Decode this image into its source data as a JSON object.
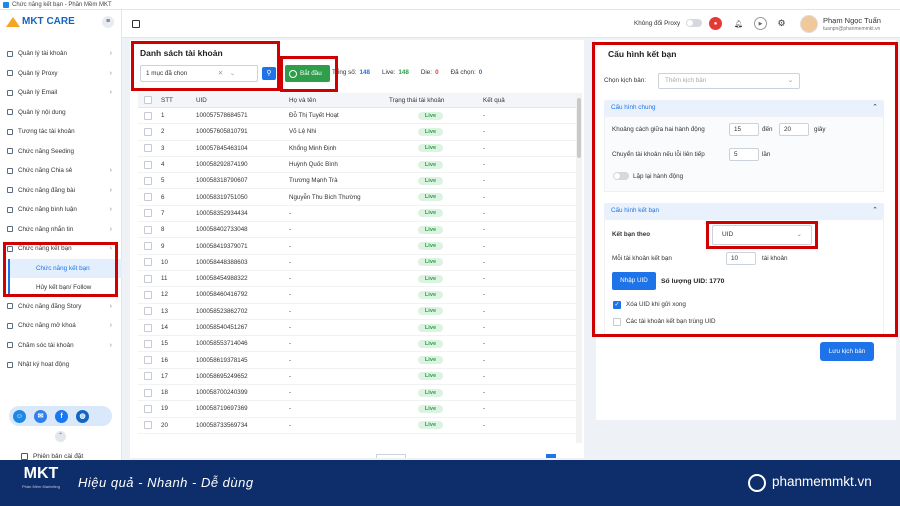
{
  "window": {
    "title": "Chức năng kết bạn - Phần Mềm MKT"
  },
  "brand": {
    "name": "MKT CARE",
    "primary_color": "#1e73e8",
    "accent_color": "#f5a623"
  },
  "sidebar": {
    "items": [
      {
        "label": "Quản lý tài khoản",
        "has_chevron": true
      },
      {
        "label": "Quản lý Proxy",
        "has_chevron": true
      },
      {
        "label": "Quản lý Email",
        "has_chevron": true
      },
      {
        "label": "Quản lý nội dung",
        "has_chevron": false
      },
      {
        "label": "Tương tác tài khoản",
        "has_chevron": false
      },
      {
        "label": "Chức năng Seeding",
        "has_chevron": false
      },
      {
        "label": "Chức năng Chia sẻ",
        "has_chevron": true
      },
      {
        "label": "Chức năng đăng bài",
        "has_chevron": true
      },
      {
        "label": "Chức năng bình luận",
        "has_chevron": true
      },
      {
        "label": "Chức năng nhắn tin",
        "has_chevron": true
      },
      {
        "label": "Chức năng kết bạn",
        "has_chevron": true
      }
    ],
    "sub_items": [
      {
        "label": "Chức năng kết bạn",
        "active": true
      },
      {
        "label": "Hủy kết bạn/ Follow",
        "active": false
      }
    ],
    "items_after": [
      {
        "label": "Chức năng đăng Story",
        "has_chevron": true
      },
      {
        "label": "Chức năng mở khoá",
        "has_chevron": true
      },
      {
        "label": "Chăm sóc tài khoản",
        "has_chevron": true
      },
      {
        "label": "Nhật ký hoạt động",
        "has_chevron": false
      }
    ],
    "version_label": "Phiên bản cài đặt"
  },
  "topbar": {
    "proxy_label": "Không đổi Proxy",
    "user_name": "Phạm Ngọc Tuấn",
    "user_email": "tuanpn@phanmemmkt.vn"
  },
  "accounts": {
    "title": "Danh sách tài khoản",
    "selected_label": "1 mục đã chọn",
    "start_label": "Bắt đầu",
    "stats": [
      {
        "label": "Tổng số:",
        "value": "148",
        "color": "#1e73e8"
      },
      {
        "label": "Live:",
        "value": "148",
        "color": "#2e9e4a"
      },
      {
        "label": "Die:",
        "value": "0",
        "color": "#e53935"
      },
      {
        "label": "Đã chọn:",
        "value": "0",
        "color": "#1e73e8"
      }
    ],
    "columns": [
      "STT",
      "UID",
      "Họ và tên",
      "Trạng thái tài khoản",
      "Kết quả"
    ],
    "rows": [
      {
        "stt": "1",
        "uid": "100057578684571",
        "name": "Đỗ Thị Tuyết Hoạt",
        "status": "Live",
        "result": "-"
      },
      {
        "stt": "2",
        "uid": "100057605810791",
        "name": "Võ Lệ Nhi",
        "status": "Live",
        "result": "-"
      },
      {
        "stt": "3",
        "uid": "100057845463104",
        "name": "Khổng Minh Định",
        "status": "Live",
        "result": "-"
      },
      {
        "stt": "4",
        "uid": "100058292874190",
        "name": "Huỳnh Quốc Bình",
        "status": "Live",
        "result": "-"
      },
      {
        "stt": "5",
        "uid": "100058318790607",
        "name": "Trương Mạnh Trà",
        "status": "Live",
        "result": "-"
      },
      {
        "stt": "6",
        "uid": "100058319751050",
        "name": "Nguyễn Thu Bích Thường",
        "status": "Live",
        "result": "-"
      },
      {
        "stt": "7",
        "uid": "100058352934434",
        "name": "-",
        "status": "Live",
        "result": "-"
      },
      {
        "stt": "8",
        "uid": "100058402733048",
        "name": "-",
        "status": "Live",
        "result": "-"
      },
      {
        "stt": "9",
        "uid": "100058419379071",
        "name": "-",
        "status": "Live",
        "result": "-"
      },
      {
        "stt": "10",
        "uid": "100058448388603",
        "name": "-",
        "status": "Live",
        "result": "-"
      },
      {
        "stt": "11",
        "uid": "100058454988322",
        "name": "-",
        "status": "Live",
        "result": "-"
      },
      {
        "stt": "12",
        "uid": "100058460416792",
        "name": "-",
        "status": "Live",
        "result": "-"
      },
      {
        "stt": "13",
        "uid": "100058523862702",
        "name": "-",
        "status": "Live",
        "result": "-"
      },
      {
        "stt": "14",
        "uid": "100058540451267",
        "name": "-",
        "status": "Live",
        "result": "-"
      },
      {
        "stt": "15",
        "uid": "100058553714046",
        "name": "-",
        "status": "Live",
        "result": "-"
      },
      {
        "stt": "16",
        "uid": "100058619378145",
        "name": "-",
        "status": "Live",
        "result": "-"
      },
      {
        "stt": "17",
        "uid": "100058695249652",
        "name": "-",
        "status": "Live",
        "result": "-"
      },
      {
        "stt": "18",
        "uid": "100058700240399",
        "name": "-",
        "status": "Live",
        "result": "-"
      },
      {
        "stt": "19",
        "uid": "100058719697369",
        "name": "-",
        "status": "Live",
        "result": "-"
      },
      {
        "stt": "20",
        "uid": "100058733569734",
        "name": "-",
        "status": "Live",
        "result": "-"
      }
    ]
  },
  "config": {
    "title": "Cấu hình kết bạn",
    "script_label": "Chọn kịch bản:",
    "script_placeholder": "Thêm kịch bản",
    "general_title": "Cấu hình chung",
    "delay_label": "Khoảng cách giữa hai hành động",
    "delay_from": "15",
    "delay_to_label": "đến",
    "delay_to": "20",
    "delay_unit": "giây",
    "switch_label": "Chuyển tài khoản nếu lỗi liên tiếp",
    "switch_value": "5",
    "switch_unit": "lần",
    "repeat_label": "Lặp lại hành động",
    "friend_title": "Cấu hình kết bạn",
    "by_label": "Kết bạn theo",
    "by_value": "UID",
    "per_account_label": "Mỗi tài khoản kết bạn",
    "per_account_value": "10",
    "per_account_unit": "tài khoản",
    "import_label": "Nhập UID",
    "uid_count": "Số lượng UID: 1770",
    "delete_uid_label": "Xóa UID khi gửi xong",
    "delete_uid_checked": true,
    "dup_label": "Các tài khoản kết bạn trùng UID",
    "dup_checked": false,
    "save_label": "Lưu kịch bản"
  },
  "banner": {
    "logo": "MKT",
    "logo_sub": "Phần Mềm Marketing",
    "slogan": "Hiệu quả - Nhanh  - Dễ dùng",
    "site": "phanmemmkt.vn"
  }
}
